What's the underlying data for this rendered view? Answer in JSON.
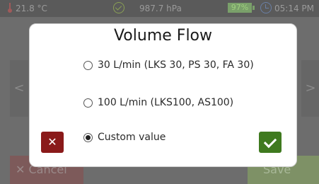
{
  "statusbar": {
    "temperature": "21.8 °C",
    "pressure": "987.7 hPa",
    "battery": "97%",
    "time": "05:14 PM"
  },
  "background": {
    "left_arrow": "<",
    "right_arrow": ">",
    "cancel_label": "Cancel",
    "save_label": "Save"
  },
  "dialog": {
    "title": "Volume Flow",
    "options": [
      {
        "label": "30 L/min (LKS 30, PS 30, FA 30)",
        "selected": false
      },
      {
        "label": "100 L/min (LKS100, AS100)",
        "selected": false
      },
      {
        "label": "Custom value",
        "selected": true
      }
    ],
    "cancel_symbol": "✕"
  },
  "colors": {
    "cancel_button": "#8a1a1a",
    "confirm_button": "#3f7a1f"
  }
}
